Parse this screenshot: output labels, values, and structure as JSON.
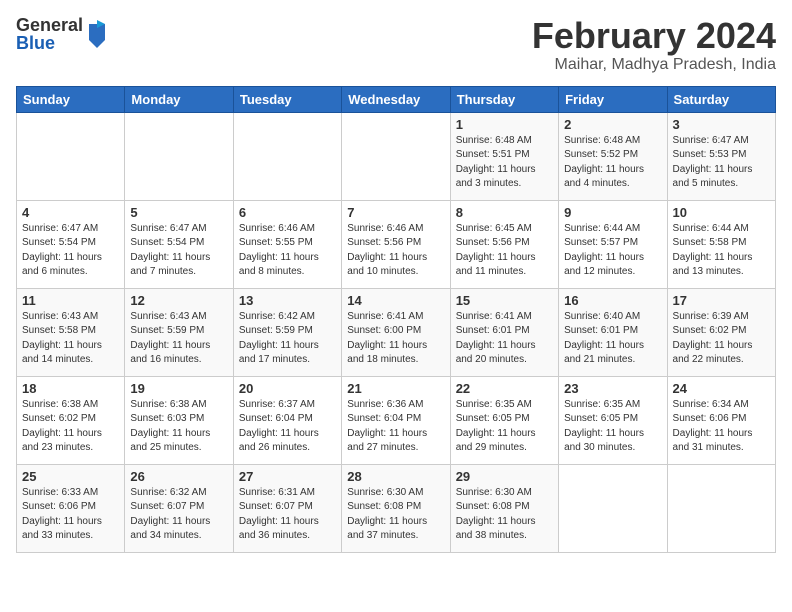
{
  "header": {
    "logo": {
      "general": "General",
      "blue": "Blue"
    },
    "title": "February 2024",
    "subtitle": "Maihar, Madhya Pradesh, India"
  },
  "weekdays": [
    "Sunday",
    "Monday",
    "Tuesday",
    "Wednesday",
    "Thursday",
    "Friday",
    "Saturday"
  ],
  "weeks": [
    [
      {
        "day": "",
        "info": ""
      },
      {
        "day": "",
        "info": ""
      },
      {
        "day": "",
        "info": ""
      },
      {
        "day": "",
        "info": ""
      },
      {
        "day": "1",
        "info": "Sunrise: 6:48 AM\nSunset: 5:51 PM\nDaylight: 11 hours\nand 3 minutes."
      },
      {
        "day": "2",
        "info": "Sunrise: 6:48 AM\nSunset: 5:52 PM\nDaylight: 11 hours\nand 4 minutes."
      },
      {
        "day": "3",
        "info": "Sunrise: 6:47 AM\nSunset: 5:53 PM\nDaylight: 11 hours\nand 5 minutes."
      }
    ],
    [
      {
        "day": "4",
        "info": "Sunrise: 6:47 AM\nSunset: 5:54 PM\nDaylight: 11 hours\nand 6 minutes."
      },
      {
        "day": "5",
        "info": "Sunrise: 6:47 AM\nSunset: 5:54 PM\nDaylight: 11 hours\nand 7 minutes."
      },
      {
        "day": "6",
        "info": "Sunrise: 6:46 AM\nSunset: 5:55 PM\nDaylight: 11 hours\nand 8 minutes."
      },
      {
        "day": "7",
        "info": "Sunrise: 6:46 AM\nSunset: 5:56 PM\nDaylight: 11 hours\nand 10 minutes."
      },
      {
        "day": "8",
        "info": "Sunrise: 6:45 AM\nSunset: 5:56 PM\nDaylight: 11 hours\nand 11 minutes."
      },
      {
        "day": "9",
        "info": "Sunrise: 6:44 AM\nSunset: 5:57 PM\nDaylight: 11 hours\nand 12 minutes."
      },
      {
        "day": "10",
        "info": "Sunrise: 6:44 AM\nSunset: 5:58 PM\nDaylight: 11 hours\nand 13 minutes."
      }
    ],
    [
      {
        "day": "11",
        "info": "Sunrise: 6:43 AM\nSunset: 5:58 PM\nDaylight: 11 hours\nand 14 minutes."
      },
      {
        "day": "12",
        "info": "Sunrise: 6:43 AM\nSunset: 5:59 PM\nDaylight: 11 hours\nand 16 minutes."
      },
      {
        "day": "13",
        "info": "Sunrise: 6:42 AM\nSunset: 5:59 PM\nDaylight: 11 hours\nand 17 minutes."
      },
      {
        "day": "14",
        "info": "Sunrise: 6:41 AM\nSunset: 6:00 PM\nDaylight: 11 hours\nand 18 minutes."
      },
      {
        "day": "15",
        "info": "Sunrise: 6:41 AM\nSunset: 6:01 PM\nDaylight: 11 hours\nand 20 minutes."
      },
      {
        "day": "16",
        "info": "Sunrise: 6:40 AM\nSunset: 6:01 PM\nDaylight: 11 hours\nand 21 minutes."
      },
      {
        "day": "17",
        "info": "Sunrise: 6:39 AM\nSunset: 6:02 PM\nDaylight: 11 hours\nand 22 minutes."
      }
    ],
    [
      {
        "day": "18",
        "info": "Sunrise: 6:38 AM\nSunset: 6:02 PM\nDaylight: 11 hours\nand 23 minutes."
      },
      {
        "day": "19",
        "info": "Sunrise: 6:38 AM\nSunset: 6:03 PM\nDaylight: 11 hours\nand 25 minutes."
      },
      {
        "day": "20",
        "info": "Sunrise: 6:37 AM\nSunset: 6:04 PM\nDaylight: 11 hours\nand 26 minutes."
      },
      {
        "day": "21",
        "info": "Sunrise: 6:36 AM\nSunset: 6:04 PM\nDaylight: 11 hours\nand 27 minutes."
      },
      {
        "day": "22",
        "info": "Sunrise: 6:35 AM\nSunset: 6:05 PM\nDaylight: 11 hours\nand 29 minutes."
      },
      {
        "day": "23",
        "info": "Sunrise: 6:35 AM\nSunset: 6:05 PM\nDaylight: 11 hours\nand 30 minutes."
      },
      {
        "day": "24",
        "info": "Sunrise: 6:34 AM\nSunset: 6:06 PM\nDaylight: 11 hours\nand 31 minutes."
      }
    ],
    [
      {
        "day": "25",
        "info": "Sunrise: 6:33 AM\nSunset: 6:06 PM\nDaylight: 11 hours\nand 33 minutes."
      },
      {
        "day": "26",
        "info": "Sunrise: 6:32 AM\nSunset: 6:07 PM\nDaylight: 11 hours\nand 34 minutes."
      },
      {
        "day": "27",
        "info": "Sunrise: 6:31 AM\nSunset: 6:07 PM\nDaylight: 11 hours\nand 36 minutes."
      },
      {
        "day": "28",
        "info": "Sunrise: 6:30 AM\nSunset: 6:08 PM\nDaylight: 11 hours\nand 37 minutes."
      },
      {
        "day": "29",
        "info": "Sunrise: 6:30 AM\nSunset: 6:08 PM\nDaylight: 11 hours\nand 38 minutes."
      },
      {
        "day": "",
        "info": ""
      },
      {
        "day": "",
        "info": ""
      }
    ]
  ]
}
